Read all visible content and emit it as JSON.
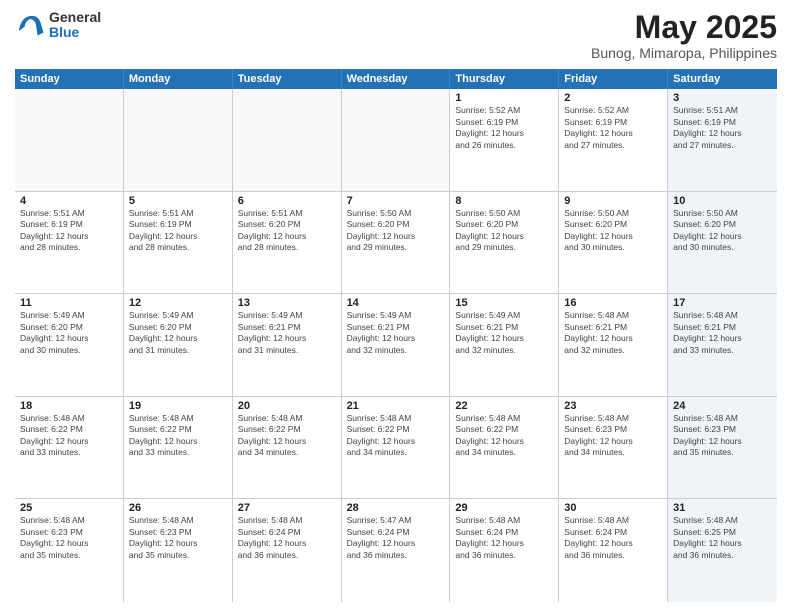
{
  "logo": {
    "general": "General",
    "blue": "Blue"
  },
  "title": "May 2025",
  "subtitle": "Bunog, Mimaropa, Philippines",
  "days": [
    "Sunday",
    "Monday",
    "Tuesday",
    "Wednesday",
    "Thursday",
    "Friday",
    "Saturday"
  ],
  "weeks": [
    [
      {
        "day": "",
        "text": "",
        "empty": true
      },
      {
        "day": "",
        "text": "",
        "empty": true
      },
      {
        "day": "",
        "text": "",
        "empty": true
      },
      {
        "day": "",
        "text": "",
        "empty": true
      },
      {
        "day": "1",
        "text": "Sunrise: 5:52 AM\nSunset: 6:19 PM\nDaylight: 12 hours\nand 26 minutes.",
        "empty": false
      },
      {
        "day": "2",
        "text": "Sunrise: 5:52 AM\nSunset: 6:19 PM\nDaylight: 12 hours\nand 27 minutes.",
        "empty": false
      },
      {
        "day": "3",
        "text": "Sunrise: 5:51 AM\nSunset: 6:19 PM\nDaylight: 12 hours\nand 27 minutes.",
        "empty": false,
        "shaded": true
      }
    ],
    [
      {
        "day": "4",
        "text": "Sunrise: 5:51 AM\nSunset: 6:19 PM\nDaylight: 12 hours\nand 28 minutes.",
        "empty": false
      },
      {
        "day": "5",
        "text": "Sunrise: 5:51 AM\nSunset: 6:19 PM\nDaylight: 12 hours\nand 28 minutes.",
        "empty": false
      },
      {
        "day": "6",
        "text": "Sunrise: 5:51 AM\nSunset: 6:20 PM\nDaylight: 12 hours\nand 28 minutes.",
        "empty": false
      },
      {
        "day": "7",
        "text": "Sunrise: 5:50 AM\nSunset: 6:20 PM\nDaylight: 12 hours\nand 29 minutes.",
        "empty": false
      },
      {
        "day": "8",
        "text": "Sunrise: 5:50 AM\nSunset: 6:20 PM\nDaylight: 12 hours\nand 29 minutes.",
        "empty": false
      },
      {
        "day": "9",
        "text": "Sunrise: 5:50 AM\nSunset: 6:20 PM\nDaylight: 12 hours\nand 30 minutes.",
        "empty": false
      },
      {
        "day": "10",
        "text": "Sunrise: 5:50 AM\nSunset: 6:20 PM\nDaylight: 12 hours\nand 30 minutes.",
        "empty": false,
        "shaded": true
      }
    ],
    [
      {
        "day": "11",
        "text": "Sunrise: 5:49 AM\nSunset: 6:20 PM\nDaylight: 12 hours\nand 30 minutes.",
        "empty": false
      },
      {
        "day": "12",
        "text": "Sunrise: 5:49 AM\nSunset: 6:20 PM\nDaylight: 12 hours\nand 31 minutes.",
        "empty": false
      },
      {
        "day": "13",
        "text": "Sunrise: 5:49 AM\nSunset: 6:21 PM\nDaylight: 12 hours\nand 31 minutes.",
        "empty": false
      },
      {
        "day": "14",
        "text": "Sunrise: 5:49 AM\nSunset: 6:21 PM\nDaylight: 12 hours\nand 32 minutes.",
        "empty": false
      },
      {
        "day": "15",
        "text": "Sunrise: 5:49 AM\nSunset: 6:21 PM\nDaylight: 12 hours\nand 32 minutes.",
        "empty": false
      },
      {
        "day": "16",
        "text": "Sunrise: 5:48 AM\nSunset: 6:21 PM\nDaylight: 12 hours\nand 32 minutes.",
        "empty": false
      },
      {
        "day": "17",
        "text": "Sunrise: 5:48 AM\nSunset: 6:21 PM\nDaylight: 12 hours\nand 33 minutes.",
        "empty": false,
        "shaded": true
      }
    ],
    [
      {
        "day": "18",
        "text": "Sunrise: 5:48 AM\nSunset: 6:22 PM\nDaylight: 12 hours\nand 33 minutes.",
        "empty": false
      },
      {
        "day": "19",
        "text": "Sunrise: 5:48 AM\nSunset: 6:22 PM\nDaylight: 12 hours\nand 33 minutes.",
        "empty": false
      },
      {
        "day": "20",
        "text": "Sunrise: 5:48 AM\nSunset: 6:22 PM\nDaylight: 12 hours\nand 34 minutes.",
        "empty": false
      },
      {
        "day": "21",
        "text": "Sunrise: 5:48 AM\nSunset: 6:22 PM\nDaylight: 12 hours\nand 34 minutes.",
        "empty": false
      },
      {
        "day": "22",
        "text": "Sunrise: 5:48 AM\nSunset: 6:22 PM\nDaylight: 12 hours\nand 34 minutes.",
        "empty": false
      },
      {
        "day": "23",
        "text": "Sunrise: 5:48 AM\nSunset: 6:23 PM\nDaylight: 12 hours\nand 34 minutes.",
        "empty": false
      },
      {
        "day": "24",
        "text": "Sunrise: 5:48 AM\nSunset: 6:23 PM\nDaylight: 12 hours\nand 35 minutes.",
        "empty": false,
        "shaded": true
      }
    ],
    [
      {
        "day": "25",
        "text": "Sunrise: 5:48 AM\nSunset: 6:23 PM\nDaylight: 12 hours\nand 35 minutes.",
        "empty": false
      },
      {
        "day": "26",
        "text": "Sunrise: 5:48 AM\nSunset: 6:23 PM\nDaylight: 12 hours\nand 35 minutes.",
        "empty": false
      },
      {
        "day": "27",
        "text": "Sunrise: 5:48 AM\nSunset: 6:24 PM\nDaylight: 12 hours\nand 36 minutes.",
        "empty": false
      },
      {
        "day": "28",
        "text": "Sunrise: 5:47 AM\nSunset: 6:24 PM\nDaylight: 12 hours\nand 36 minutes.",
        "empty": false
      },
      {
        "day": "29",
        "text": "Sunrise: 5:48 AM\nSunset: 6:24 PM\nDaylight: 12 hours\nand 36 minutes.",
        "empty": false
      },
      {
        "day": "30",
        "text": "Sunrise: 5:48 AM\nSunset: 6:24 PM\nDaylight: 12 hours\nand 36 minutes.",
        "empty": false
      },
      {
        "day": "31",
        "text": "Sunrise: 5:48 AM\nSunset: 6:25 PM\nDaylight: 12 hours\nand 36 minutes.",
        "empty": false,
        "shaded": true
      }
    ]
  ]
}
